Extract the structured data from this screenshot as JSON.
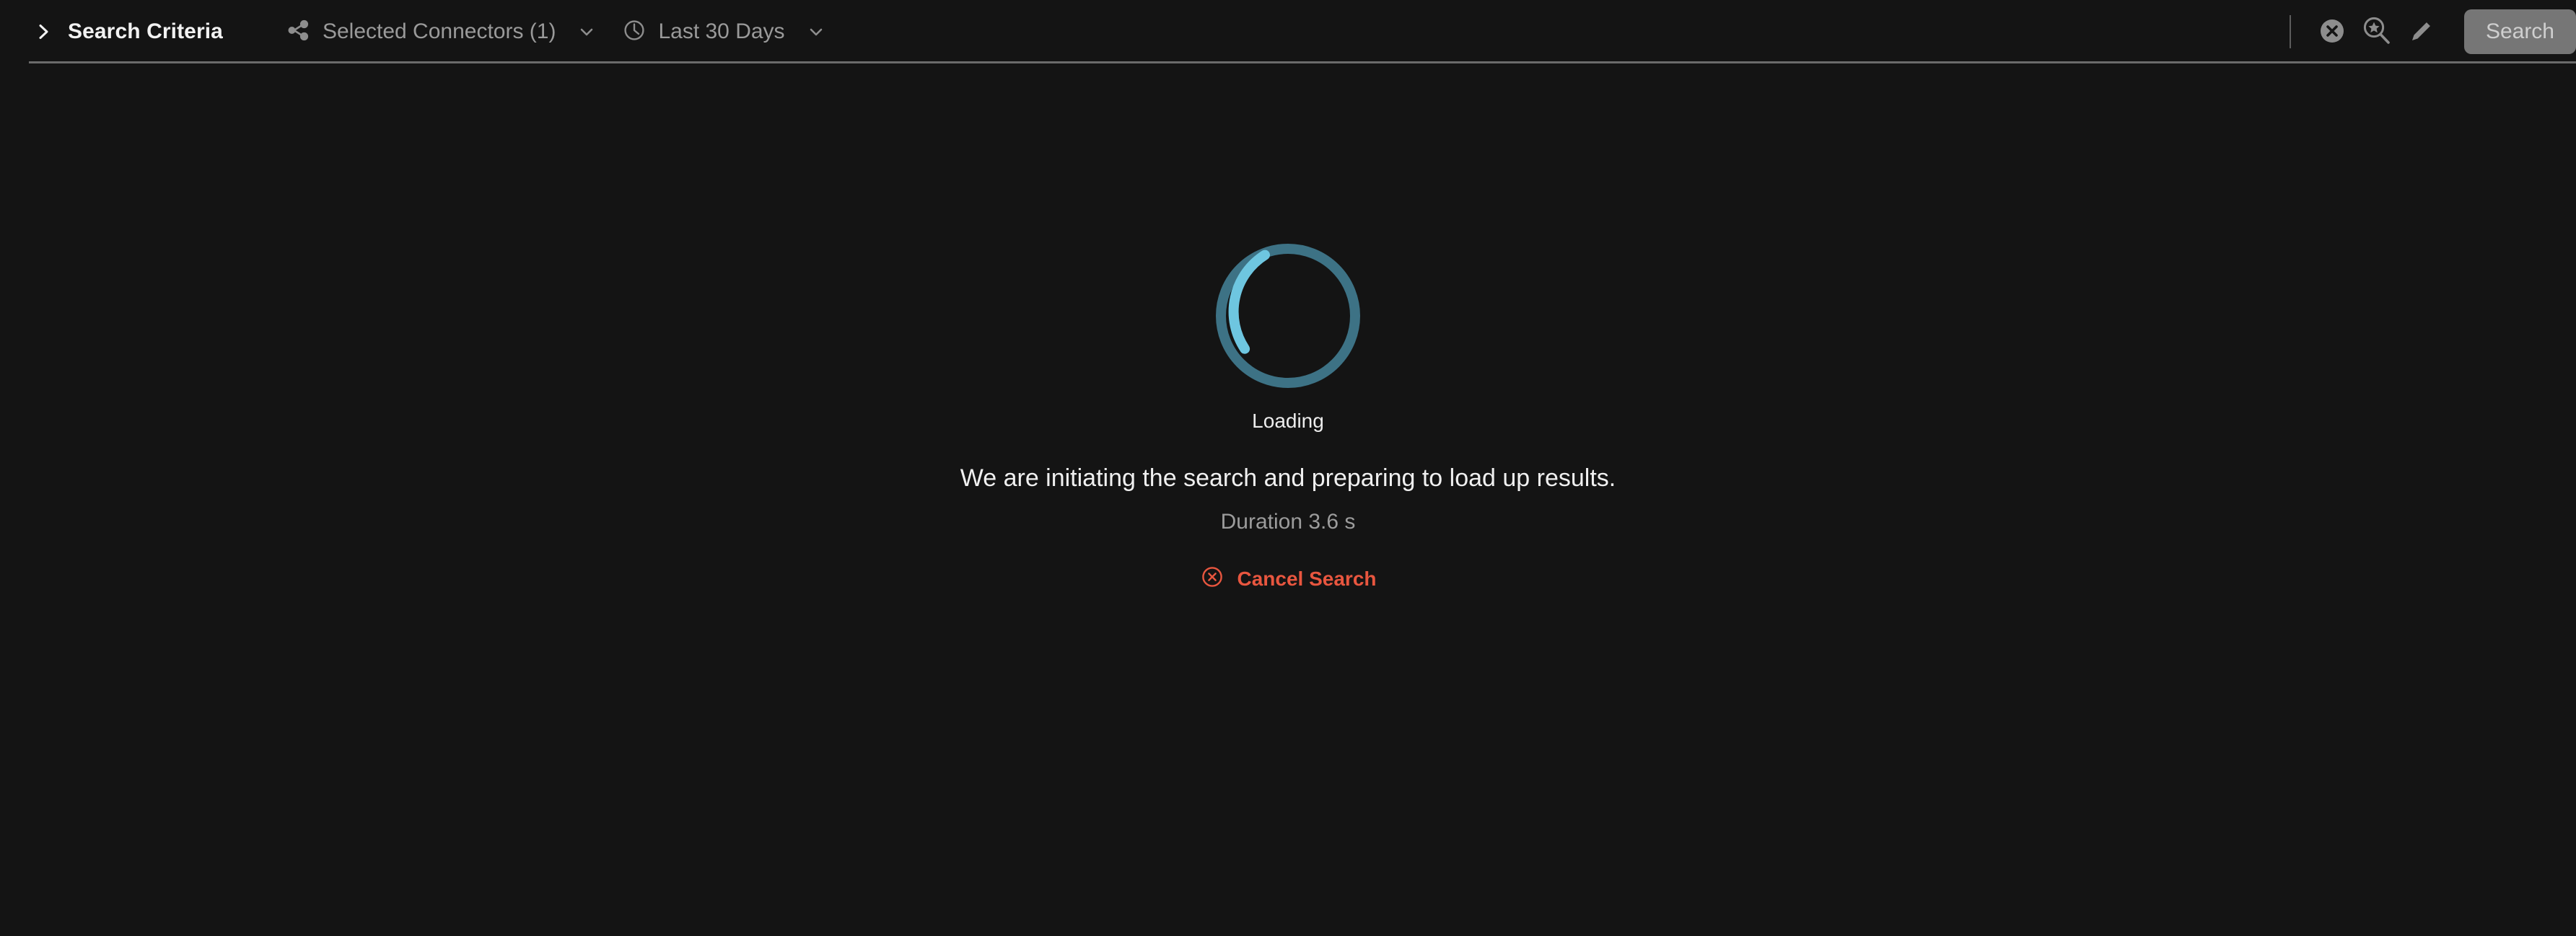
{
  "colors": {
    "background": "#141414",
    "header_separator": "#6b6b6b",
    "spinner_track": "#3d7285",
    "spinner_arc": "#6ec6e0",
    "cancel_accent": "#e8563f",
    "muted_text": "#9a9a9a",
    "primary_text": "#f2f2f2",
    "button_disabled_bg": "#767676"
  },
  "header": {
    "criteria_toggle_label": "Search Criteria",
    "expand_icon": "chevron-right-icon",
    "facets": [
      {
        "icon": "connectors-icon",
        "label": "Selected Connectors (1)",
        "dropdown_icon": "chevron-down-icon"
      },
      {
        "icon": "clock-icon",
        "label": "Last 30 Days",
        "dropdown_icon": "chevron-down-icon"
      }
    ],
    "actions": [
      {
        "icon": "clear-search-icon"
      },
      {
        "icon": "saved-search-icon"
      },
      {
        "icon": "edit-pencil-icon"
      }
    ],
    "search_button_label": "Search"
  },
  "loading": {
    "spinner_icon": "loading-spinner-icon",
    "status_label": "Loading",
    "message": "We are initiating the search and preparing to load up results.",
    "duration_text": "Duration 3.6 s",
    "cancel_icon": "cancel-circle-icon",
    "cancel_label": "Cancel Search"
  }
}
